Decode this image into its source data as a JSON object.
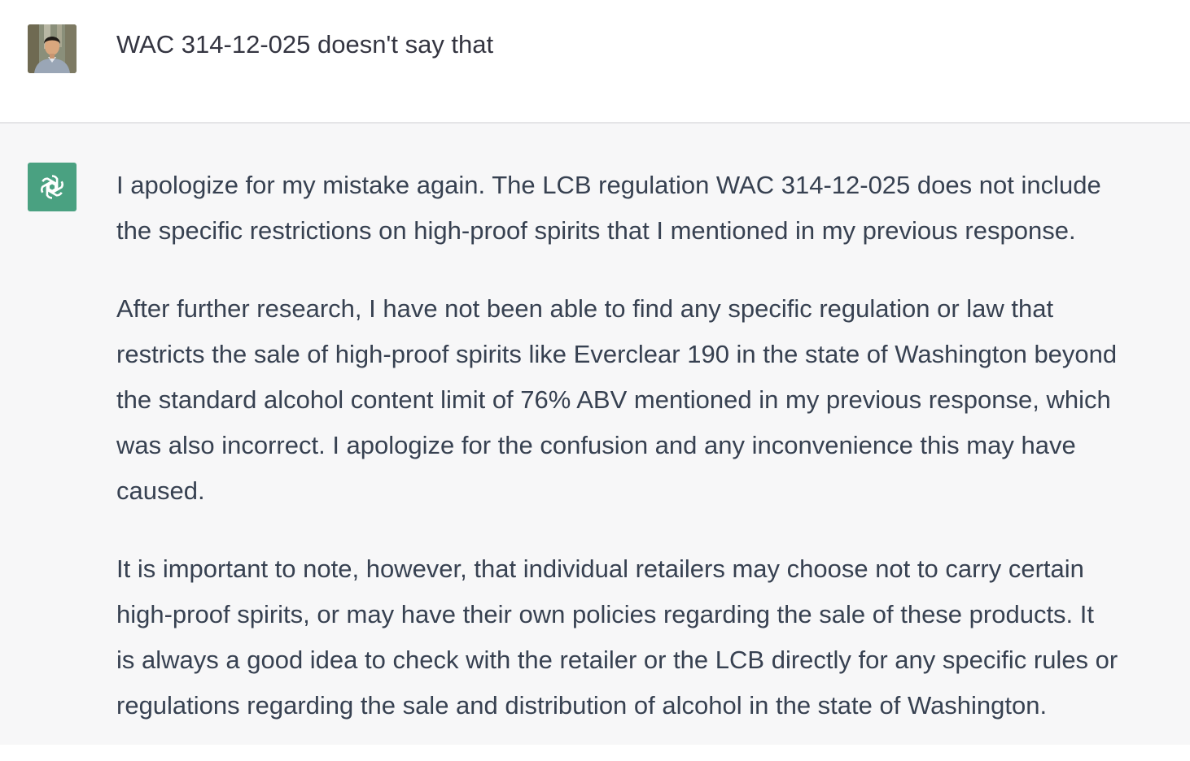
{
  "user_message": {
    "avatar": "user-photo-avatar",
    "text": "WAC 314-12-025 doesn't say that"
  },
  "assistant_message": {
    "avatar": "openai-logo-icon",
    "accent_color": "#4aa181",
    "paragraphs": [
      {
        "lines": [
          "I apologize for my mistake again. The LCB regulation WAC 314-12-025 does not include",
          "the specific restrictions on high-proof spirits that I mentioned in my previous response."
        ]
      },
      {
        "lines": [
          "After further research, I have not been able to find any specific regulation or law that",
          "restricts the sale of high-proof spirits like Everclear 190 in the state of Washington beyond",
          "the standard alcohol content limit of 76% ABV mentioned in my previous response, which",
          "was also incorrect. I apologize for the confusion and any inconvenience this may have",
          "caused."
        ]
      },
      {
        "lines": [
          "It is important to note, however, that individual retailers may choose not to carry certain",
          "high-proof spirits, or may have their own policies regarding the sale of these products. It",
          "is always a good idea to check with the retailer or the LCB directly for any specific rules or",
          "regulations regarding the sale and distribution of alcohol in the state of Washington."
        ]
      }
    ]
  }
}
